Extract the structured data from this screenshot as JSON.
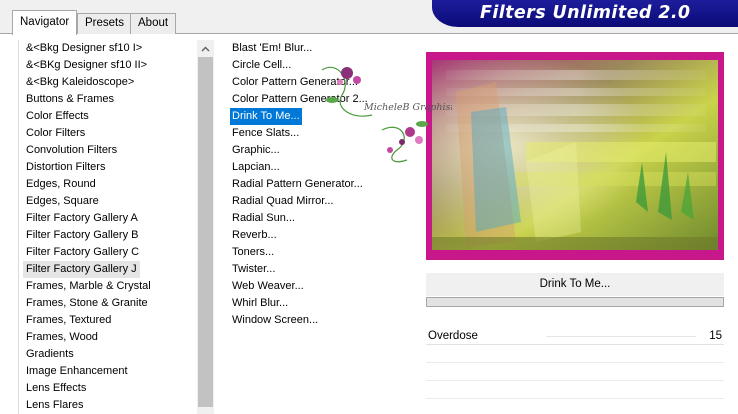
{
  "tabs": [
    {
      "label": "Navigator",
      "active": true
    },
    {
      "label": "Presets",
      "active": false
    },
    {
      "label": "About",
      "active": false
    }
  ],
  "banner": {
    "title": "Filters Unlimited 2.0",
    "color": "#0b0b78"
  },
  "categories": {
    "selected_index": 14,
    "items": [
      "&<Bkg Designer sf10 I>",
      "&<BKg Designer sf10 II>",
      "&<Bkg Kaleidoscope>",
      "Buttons & Frames",
      "Color Effects",
      "Color Filters",
      "Convolution Filters",
      "Distortion Filters",
      "Edges, Round",
      "Edges, Square",
      "Filter Factory Gallery A",
      "Filter Factory Gallery B",
      "Filter Factory Gallery C",
      "Filter Factory Gallery J",
      "Frames, Marble & Crystal",
      "Frames, Stone & Granite",
      "Frames, Textured",
      "Frames, Wood",
      "Gradients",
      "Image Enhancement",
      "Lens Effects",
      "Lens Flares"
    ]
  },
  "filters": {
    "selected_index": 4,
    "items": [
      "Blast 'Em! Blur...",
      "Circle Cell...",
      "Color Pattern Generator...",
      "Color Pattern Generator 2...",
      "Drink To Me...",
      "Fence Slats...",
      "Graphic...",
      "Lapcian...",
      "Radial Pattern Generator...",
      "Radial Quad Mirror...",
      "Radial Sun...",
      "Reverb...",
      "Toners...",
      "Twister...",
      "Web Weaver...",
      "Whirl Blur...",
      "Window Screen..."
    ]
  },
  "preview": {
    "filter_name": "Drink To Me...",
    "progress": 0
  },
  "params": [
    {
      "name": "Overdose",
      "value": "15"
    }
  ],
  "watermark": {
    "text": "MicheleB Graphisme"
  },
  "colors": {
    "selection": "#0078d7",
    "preview_border": "#c8178a"
  }
}
